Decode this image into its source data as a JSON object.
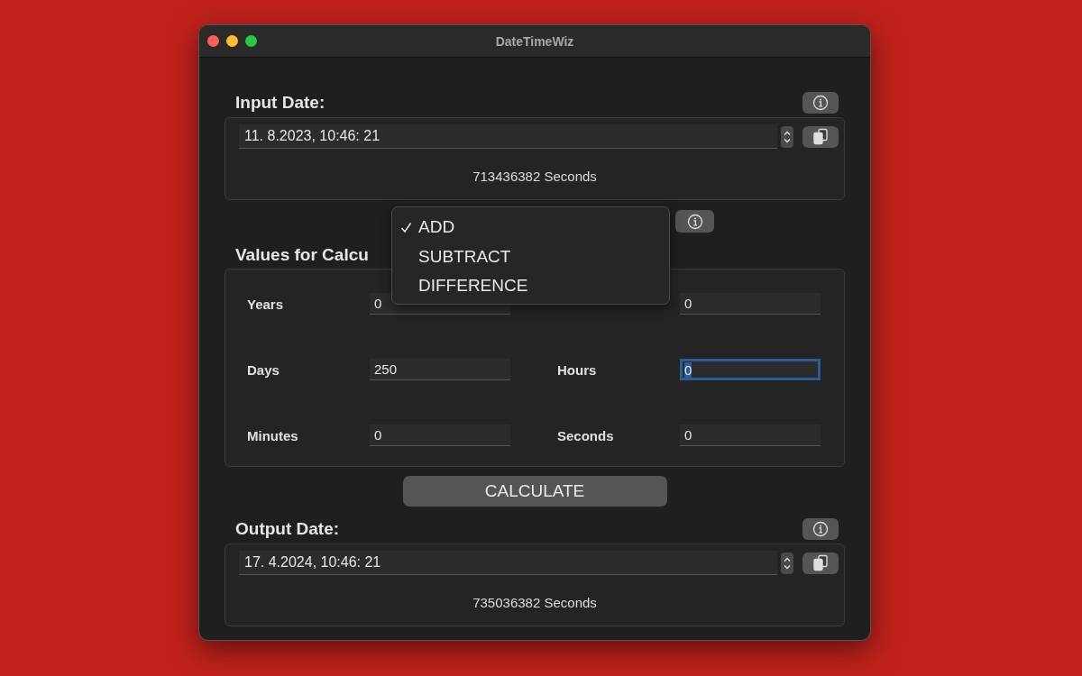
{
  "window": {
    "title": "DateTimeWiz"
  },
  "input_section": {
    "heading": "Input Date:",
    "date": "11. 8.2023, 10:46: 21",
    "seconds": "713436382 Seconds"
  },
  "operation_menu": {
    "items": [
      {
        "label": "ADD",
        "selected": true
      },
      {
        "label": "SUBTRACT",
        "selected": false
      },
      {
        "label": "DIFFERENCE",
        "selected": false
      }
    ]
  },
  "values_section": {
    "heading": "Values for Calcu",
    "fields": [
      {
        "label": "Years",
        "value": "0",
        "focused": false
      },
      {
        "value": "0",
        "focused": false
      },
      {
        "label": "Days",
        "value": "250",
        "focused": false
      },
      {
        "label": "Hours",
        "value": "0",
        "focused": true
      },
      {
        "label": "Minutes",
        "value": "0",
        "focused": false
      },
      {
        "label": "Seconds",
        "value": "0",
        "focused": false
      }
    ]
  },
  "calculate_button": "CALCULATE",
  "output_section": {
    "heading": "Output Date:",
    "date": "17. 4.2024, 10:46: 21",
    "seconds": "735036382 Seconds"
  }
}
